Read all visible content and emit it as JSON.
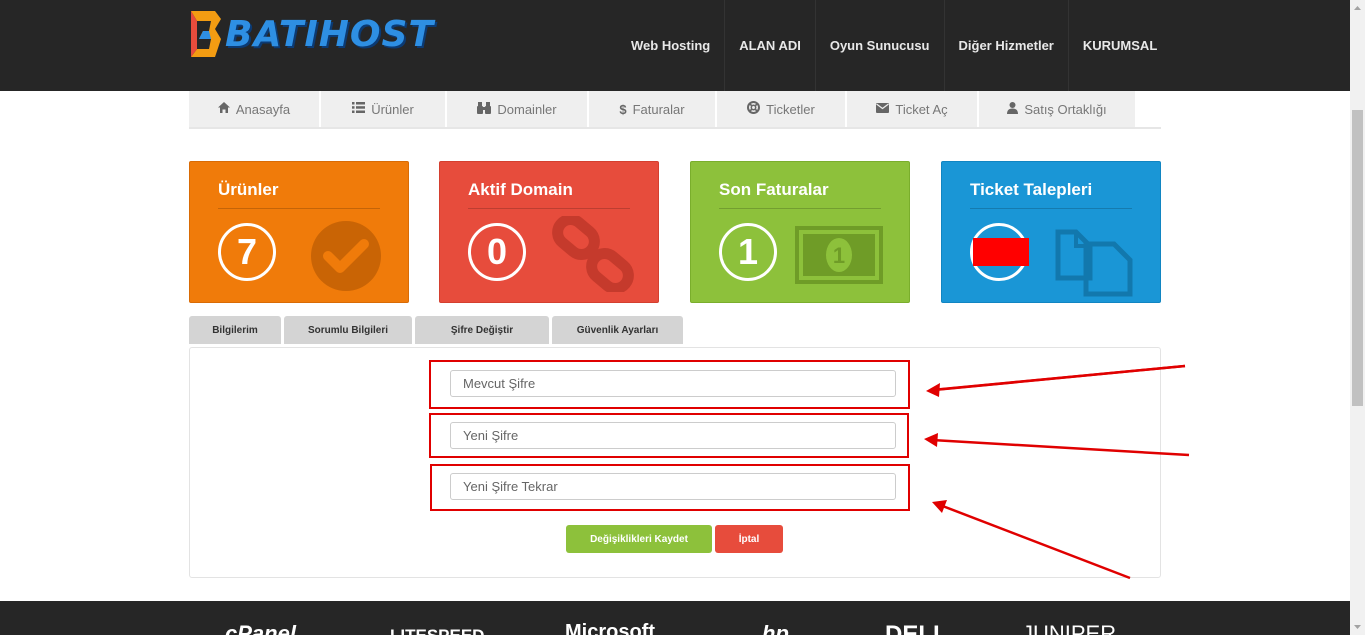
{
  "header": {
    "logo_text": "BATIHOST",
    "nav": [
      "Web Hosting",
      "ALAN ADI",
      "Oyun Sunucusu",
      "Diğer Hizmetler",
      "KURUMSAL"
    ]
  },
  "subnav": [
    {
      "label": "Anasayfa",
      "icon": "home-icon"
    },
    {
      "label": "Ürünler",
      "icon": "list-icon"
    },
    {
      "label": "Domainler",
      "icon": "binoculars-icon"
    },
    {
      "label": "Faturalar",
      "icon": "dollar-icon"
    },
    {
      "label": "Ticketler",
      "icon": "lifebuoy-icon"
    },
    {
      "label": "Ticket Aç",
      "icon": "envelope-icon"
    },
    {
      "label": "Satış Ortaklığı",
      "icon": "user-icon"
    }
  ],
  "cards": [
    {
      "title": "Ürünler",
      "value": "7",
      "color": "#f07b0a",
      "icon": "check-circle-icon"
    },
    {
      "title": "Aktif Domain",
      "value": "0",
      "color": "#e74c3c",
      "icon": "chain-link-icon"
    },
    {
      "title": "Son Faturalar",
      "value": "1",
      "color": "#8dc13b",
      "icon": "money-bill-icon"
    },
    {
      "title": "Ticket Talepleri",
      "value": "",
      "color": "#1a96d6",
      "icon": "copy-icon"
    }
  ],
  "profile_tabs": [
    "Bilgilerim",
    "Sorumlu Bilgileri",
    "Şifre Değiştir",
    "Güvenlik Ayarları"
  ],
  "form": {
    "current_password_placeholder": "Mevcut Şifre",
    "new_password_placeholder": "Yeni Şifre",
    "confirm_password_placeholder": "Yeni Şifre Tekrar",
    "save_label": "Değişiklikleri Kaydet",
    "cancel_label": "İptal"
  },
  "footer": {
    "brands": [
      "cPanel",
      "LITESPEED",
      "Microsoft",
      "hp",
      "DELL",
      "JUNIPER"
    ]
  }
}
